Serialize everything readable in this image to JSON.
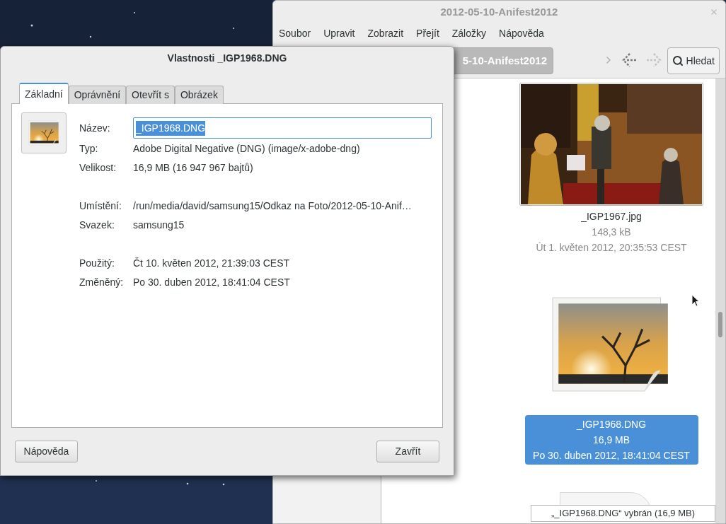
{
  "file_manager": {
    "title": "2012-05-10-Anifest2012",
    "menu": [
      "Soubor",
      "Upravit",
      "Zobrazit",
      "Přejít",
      "Záložky",
      "Nápověda"
    ],
    "path_button": "5-10-Anifest2012",
    "search_button": "Hledat",
    "files": [
      {
        "name": "_IGP1967.jpg",
        "size": "148,3 kB",
        "modified": "Út 1. květen 2012, 20:35:53 CEST",
        "selected": false
      },
      {
        "kind": "image-icon",
        "name": "_IGP1968.DNG",
        "size": "16,9 MB",
        "modified": "Po 30. duben 2012, 18:41:04 CEST",
        "selected": true
      }
    ],
    "status": "„_IGP1968.DNG“ vybrán (16,9 MB)"
  },
  "dialog": {
    "title": "Vlastnosti _IGP1968.DNG",
    "tabs": [
      {
        "label": "Základní",
        "selected": true
      },
      {
        "label": "Oprávnění",
        "selected": false
      },
      {
        "label": "Otevřít s",
        "selected": false
      },
      {
        "label": "Obrázek",
        "selected": false
      }
    ],
    "name_label": "Název:",
    "name_value": "_IGP1968.DNG",
    "property_groups": [
      [
        {
          "label": "Typ:",
          "value": "Adobe Digital Negative (DNG) (image/x-adobe-dng)"
        },
        {
          "label": "Velikost:",
          "value": "16,9 MB (16 947 967 bajtů)"
        }
      ],
      [
        {
          "label": "Umístění:",
          "value": "/run/media/david/samsung15/Odkaz na Foto/2012-05-10-Anif…"
        },
        {
          "label": "Svazek:",
          "value": "samsung15"
        }
      ],
      [
        {
          "label": "Použitý:",
          "value": "Čt 10. květen 2012, 21:39:03 CEST"
        },
        {
          "label": "Změněný:",
          "value": "Po 30. duben 2012, 18:41:04 CEST"
        }
      ]
    ],
    "buttons": [
      "Nápověda",
      "Zavřít"
    ]
  }
}
